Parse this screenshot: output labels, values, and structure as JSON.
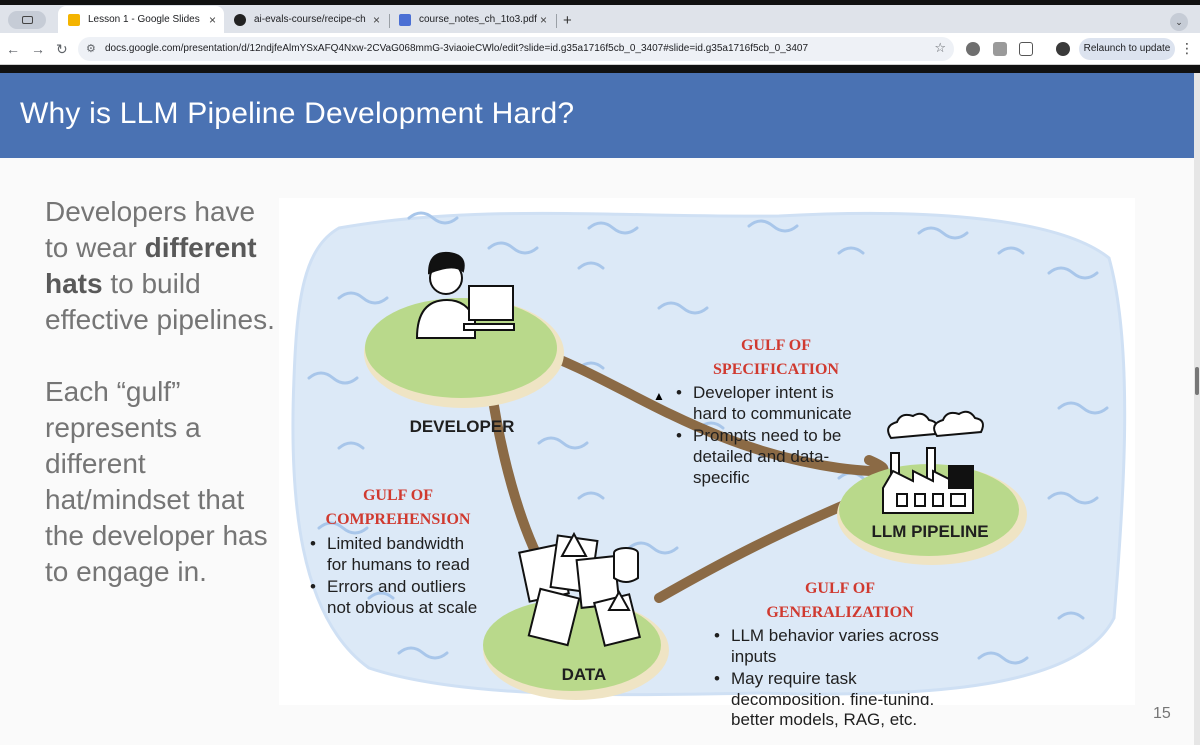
{
  "browser": {
    "tabs": [
      {
        "title": "Lesson 1 - Google Slides",
        "active": true,
        "favicon_color": "#f4b400"
      },
      {
        "title": "ai-evals-course/recipe-chatb",
        "active": false,
        "favicon_color": "#222222"
      },
      {
        "title": "course_notes_ch_1to3.pdf",
        "active": false,
        "favicon_color": "#4a6fd4"
      }
    ],
    "close_glyph": "×",
    "new_tab_glyph": "+",
    "tab_menu_glyph": "⌄",
    "nav": {
      "back": "←",
      "forward": "→",
      "reload": "↻"
    },
    "url": "docs.google.com/presentation/d/12ndjfeAlmYSxAFQ4Nxw-2CVaG068mmG-3viaoieCWlo/edit?slide=id.g35a1716f5cb_0_3407#slide=id.g35a1716f5cb_0_3407",
    "star_glyph": "☆",
    "relaunch_label": "Relaunch to update",
    "menu_glyph": "⋮"
  },
  "slide": {
    "title": "Why is LLM Pipeline Development Hard?",
    "left_text": {
      "p1_before": "Developers have to wear ",
      "p1_bold": "different hats",
      "p1_after": " to build effective pipelines.",
      "p2": "Each “gulf” represents a different hat/mindset that the developer has to engage in."
    },
    "page_number": "15",
    "diagram": {
      "nodes": {
        "developer": "DEVELOPER",
        "llm_pipeline": "LLM PIPELINE",
        "data": "DATA"
      },
      "gulf_specification": {
        "title_line1": "GULF OF",
        "title_line2": "SPECIFICATION",
        "b1_l1": "Developer intent is",
        "b1_l2": "hard to communicate",
        "b2_l1": "Prompts need to be",
        "b2_l2": "detailed and data-",
        "b2_l3": "specific"
      },
      "gulf_comprehension": {
        "title_line1": "GULF OF",
        "title_line2": "COMPREHENSION",
        "b1_l1": "Limited bandwidth",
        "b1_l2": "for humans to read",
        "b2_l1": "Errors and outliers",
        "b2_l2": "not obvious at scale"
      },
      "gulf_generalization": {
        "title_line1": "GULF OF",
        "title_line2": "GENERALIZATION",
        "b1_l1": "LLM behavior varies across",
        "b1_l2": "inputs",
        "b2_l1": "May require task",
        "b2_l2": "decomposition, fine-tuning,",
        "b2_l3": "better models, RAG, etc."
      },
      "bullet": "•",
      "colors": {
        "sea": "#dce9f7",
        "wave": "#a8c6ea",
        "island": "#b9d98b",
        "sand": "#efe4c4",
        "road": "#8b6a45",
        "gulf_title": "#d03a30",
        "text": "#1f1f1f"
      }
    }
  },
  "colors": {
    "header_bg": "#4a72b3",
    "left_text": "#757575"
  }
}
